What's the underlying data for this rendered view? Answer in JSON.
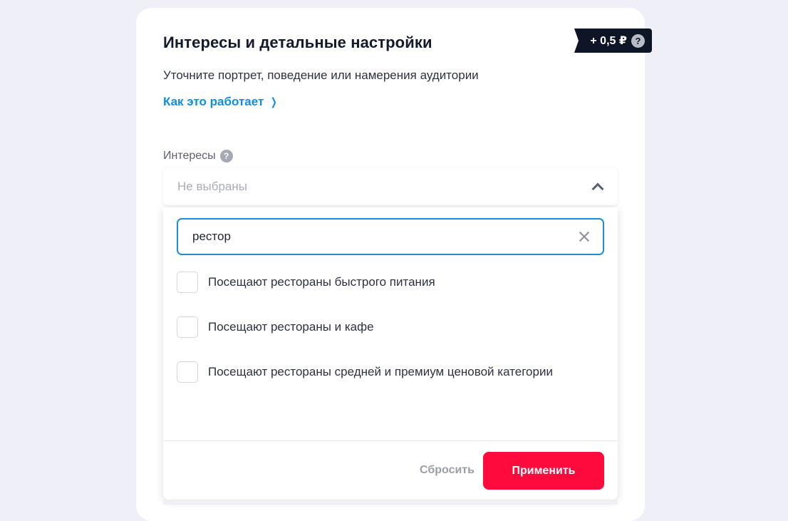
{
  "badge": {
    "price": "+ 0,5 ₽",
    "help": "?"
  },
  "header": {
    "title": "Интересы и детальные настройки",
    "subtitle": "Уточните портрет, поведение или намерения аудитории",
    "link": "Как это работает",
    "link_chevron": "❯"
  },
  "interests": {
    "label": "Интересы",
    "help": "?",
    "selected_value": "Не выбраны",
    "search": {
      "value": "рестор",
      "placeholder": ""
    },
    "options": [
      {
        "label": "Посещают рестораны быстрого питания",
        "checked": false
      },
      {
        "label": "Посещают рестораны и кафе",
        "checked": false
      },
      {
        "label": "Посещают рестораны средней и премиум ценовой категории",
        "checked": false
      }
    ],
    "reset_label": "Сбросить",
    "apply_label": "Применить"
  },
  "colors": {
    "accent": "#ff0a3c",
    "link": "#0f8ee0",
    "focus_border": "#1f8dd6",
    "badge_bg": "#0e1526"
  }
}
